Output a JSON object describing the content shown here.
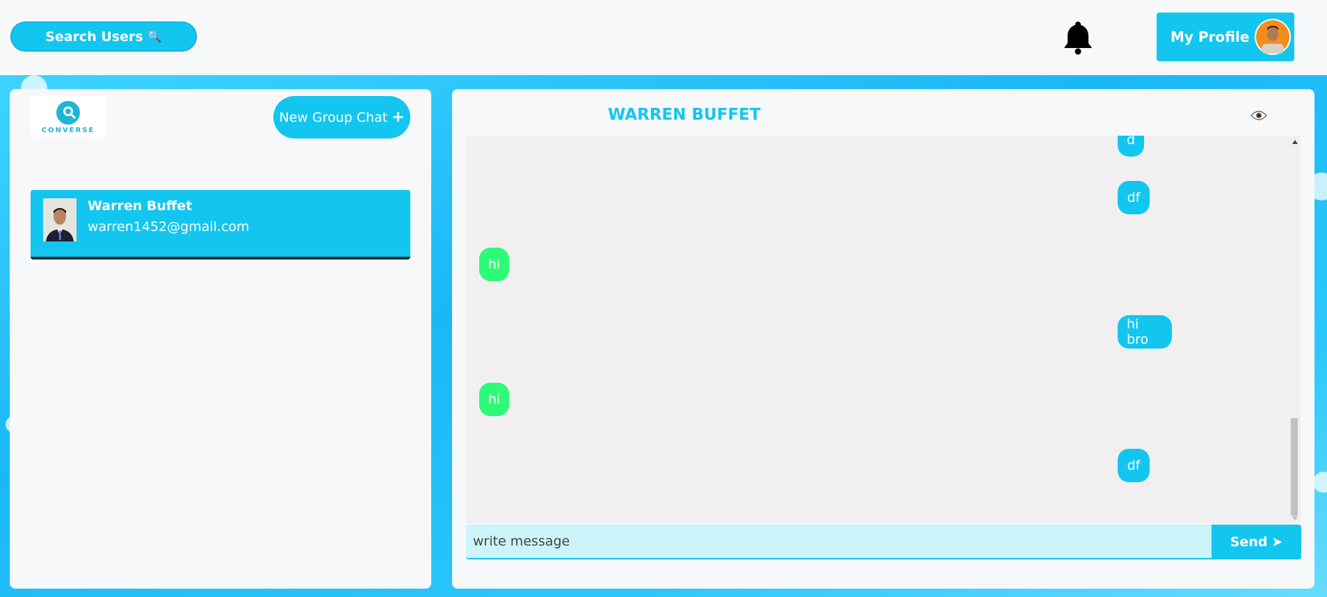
{
  "header": {
    "search_label": "Search Users",
    "search_icon": "🔍",
    "profile_label": "My Profile"
  },
  "sidebar": {
    "logo_text": "CONVERSE",
    "new_group_label": "New Group Chat",
    "new_group_icon": "+",
    "chats": [
      {
        "name": "Warren Buffet",
        "email": "warren1452@gmail.com"
      }
    ]
  },
  "chat": {
    "title": "WARREN BUFFET",
    "messages": [
      {
        "text": "d",
        "side": "sent"
      },
      {
        "text": "df",
        "side": "sent"
      },
      {
        "text": "hi",
        "side": "received"
      },
      {
        "text": "hi bro",
        "side": "sent"
      },
      {
        "text": "hi",
        "side": "received"
      },
      {
        "text": "df",
        "side": "sent"
      }
    ],
    "input_placeholder": "write message",
    "send_label": "Send",
    "send_icon": "➤"
  },
  "colors": {
    "accent": "#12c6ef",
    "received_bubble": "#2dfb78",
    "message_area": "#f1eff0"
  }
}
